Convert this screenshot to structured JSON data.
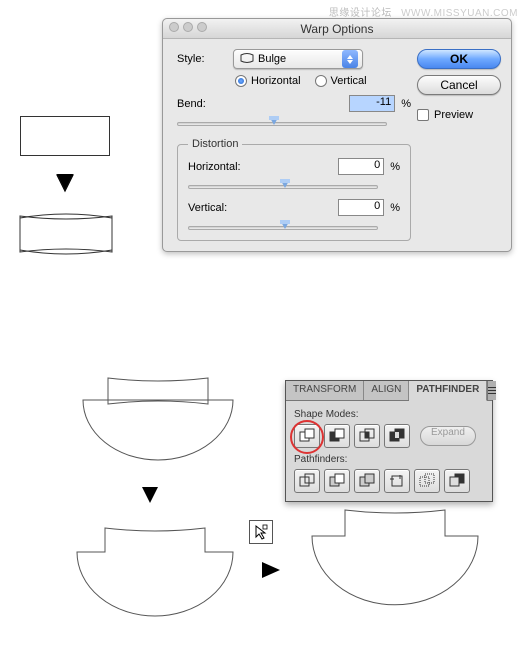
{
  "watermark": {
    "cn": "思缘设计论坛",
    "url": "WWW.MISSYUAN.COM"
  },
  "dialog": {
    "title": "Warp Options",
    "style_label": "Style:",
    "style_value": "Bulge",
    "orientation": {
      "horizontal": "Horizontal",
      "vertical": "Vertical",
      "selected": "horizontal"
    },
    "bend_label": "Bend:",
    "bend_value": "-11",
    "pct": "%",
    "distortion_legend": "Distortion",
    "dist_h_label": "Horizontal:",
    "dist_h_value": "0",
    "dist_v_label": "Vertical:",
    "dist_v_value": "0",
    "ok": "OK",
    "cancel": "Cancel",
    "preview": "Preview"
  },
  "panel": {
    "tabs": {
      "transform": "TRANSFORM",
      "align": "ALIGN",
      "pathfinder": "PATHFINDER"
    },
    "shape_modes": "Shape Modes:",
    "expand": "Expand",
    "pathfinders": "Pathfinders:"
  }
}
